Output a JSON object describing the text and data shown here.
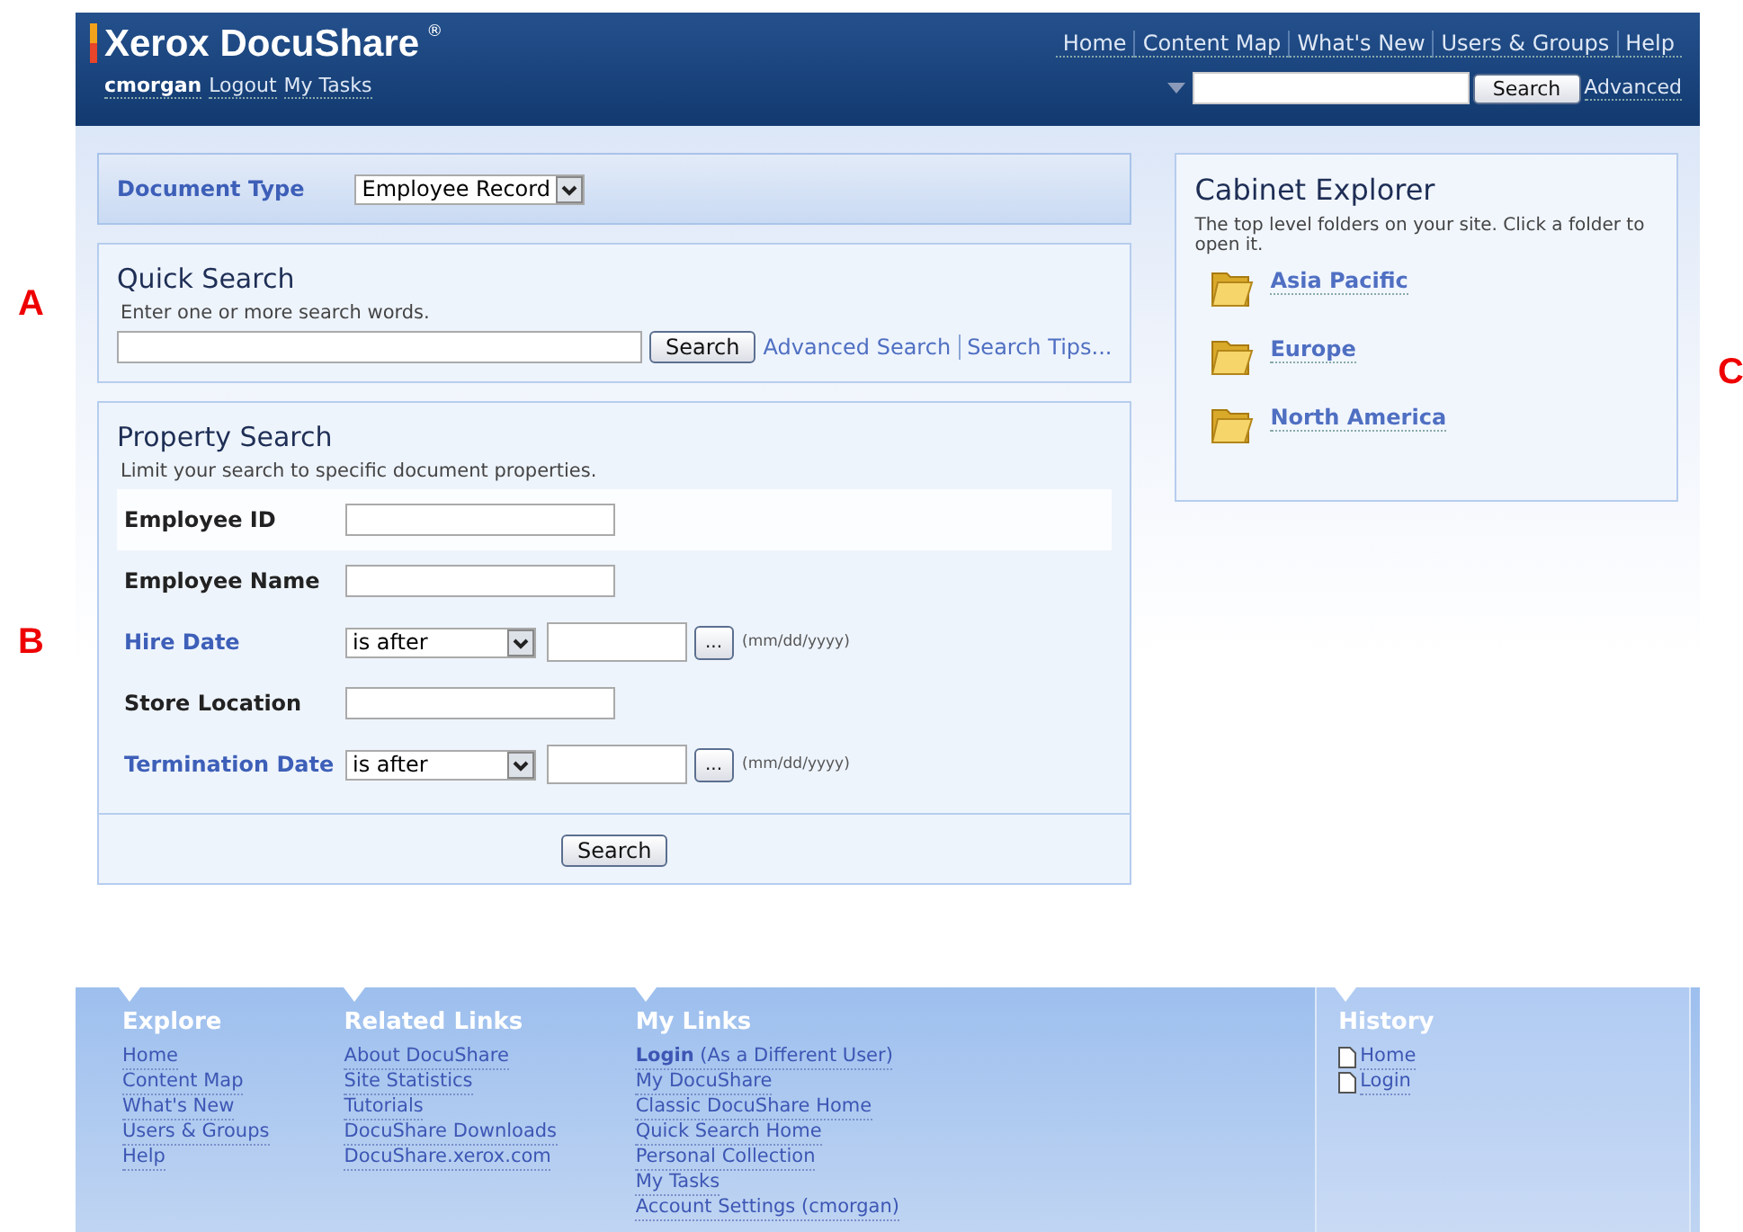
{
  "header": {
    "logo": "Xerox DocuShare",
    "logo_mark": "®",
    "user": "cmorgan",
    "user_links": [
      "Logout",
      "My Tasks"
    ],
    "nav": [
      "Home",
      "Content Map",
      "What's New",
      "Users & Groups",
      "Help"
    ],
    "search_button": "Search",
    "advanced": "Advanced"
  },
  "document_type": {
    "label": "Document Type",
    "value": "Employee Record"
  },
  "quick_search": {
    "title": "Quick Search",
    "hint": "Enter one or more search words.",
    "button": "Search",
    "links": [
      "Advanced Search",
      "Search Tips..."
    ]
  },
  "property_search": {
    "title": "Property Search",
    "hint": "Limit your search to specific document properties.",
    "fields": [
      {
        "label": "Employee ID",
        "kind": "text",
        "highlighted": true
      },
      {
        "label": "Employee Name",
        "kind": "text",
        "highlighted": false
      },
      {
        "label": "Hire Date",
        "kind": "date",
        "highlighted": false,
        "operator": "is after",
        "picker": "...",
        "format": "(mm/dd/yyyy)"
      },
      {
        "label": "Store Location",
        "kind": "text",
        "highlighted": false
      },
      {
        "label": "Termination Date",
        "kind": "date",
        "highlighted": false,
        "operator": "is after",
        "picker": "...",
        "format": "(mm/dd/yyyy)"
      }
    ],
    "button": "Search"
  },
  "cabinet_explorer": {
    "title": "Cabinet Explorer",
    "hint": "The top level folders on your site. Click a folder to open it.",
    "folders": [
      "Asia Pacific",
      "Europe",
      "North America"
    ]
  },
  "footer": {
    "columns": [
      {
        "title": "Explore",
        "links": [
          {
            "text": "Home"
          },
          {
            "text": "Content Map"
          },
          {
            "text": "What's New"
          },
          {
            "text": "Users & Groups"
          },
          {
            "text": "Help"
          }
        ]
      },
      {
        "title": "Related Links",
        "links": [
          {
            "text": "About DocuShare"
          },
          {
            "text": "Site Statistics"
          },
          {
            "text": "Tutorials"
          },
          {
            "text": "DocuShare Downloads"
          },
          {
            "text": "DocuShare.xerox.com"
          }
        ]
      },
      {
        "title": "My Links",
        "links": [
          {
            "text": "**Login** (As a Different User)"
          },
          {
            "text": "My DocuShare"
          },
          {
            "text": "Classic DocuShare Home"
          },
          {
            "text": "Quick Search Home"
          },
          {
            "text": "Personal Collection"
          },
          {
            "text": "My Tasks"
          },
          {
            "text": "Account Settings (cmorgan)"
          }
        ]
      }
    ],
    "history": {
      "title": "History",
      "links": [
        "Home",
        "Login"
      ]
    }
  },
  "annotations": [
    "A",
    "B",
    "C"
  ]
}
